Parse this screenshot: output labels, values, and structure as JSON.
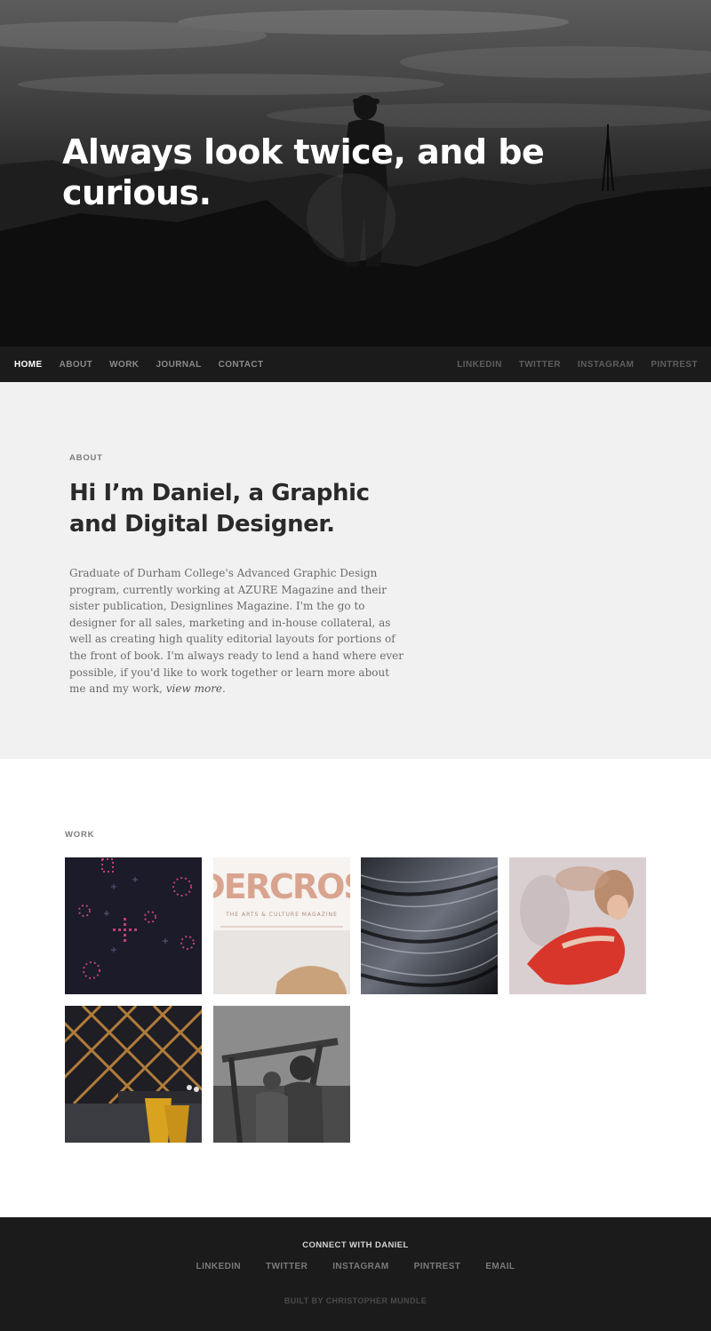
{
  "hero": {
    "title": "Always look twice, and be curious.",
    "image": "black-and-white-silhouette-on-hilltop"
  },
  "nav": {
    "left": [
      {
        "label": "HOME",
        "active": true
      },
      {
        "label": "ABOUT"
      },
      {
        "label": "WORK"
      },
      {
        "label": "JOURNAL"
      },
      {
        "label": "CONTACT"
      }
    ],
    "right": [
      {
        "label": "LINKEDIN"
      },
      {
        "label": "TWITTER"
      },
      {
        "label": "INSTAGRAM"
      },
      {
        "label": "PINTREST"
      }
    ]
  },
  "about": {
    "label": "ABOUT",
    "heading": "Hi I’m Daniel, a Graphic and Digital Designer.",
    "body": "Graduate of Durham College's Advanced Graphic Design program, currently working at AZURE Magazine and their sister publication, Designlines Magazine. I'm the go to designer for all sales, marketing and in-house collateral, as well as creating high quality editorial layouts for portions of the front of book. I'm always ready to lend a hand where ever possible, if you'd like to work together or learn more about me and my work, ",
    "link": "view more",
    "trailing": "."
  },
  "work": {
    "label": "WORK",
    "tiles": [
      {
        "name": "dark-pattern-dots"
      },
      {
        "name": "magazine-cover",
        "text": "DERCROS",
        "subtext": "THE ARTS & CULTURE MAGAZINE"
      },
      {
        "name": "metallic-texture"
      },
      {
        "name": "dancer-red-dress"
      },
      {
        "name": "restaurant-lattice"
      },
      {
        "name": "bw-workers"
      }
    ]
  },
  "footer": {
    "title": "CONNECT WITH DANIEL",
    "links": [
      {
        "label": "LINKEDIN"
      },
      {
        "label": "TWITTER"
      },
      {
        "label": "INSTAGRAM"
      },
      {
        "label": "PINTREST"
      },
      {
        "label": "EMAIL"
      }
    ],
    "credit": "BUILT BY CHRISTOPHER MUNDLE"
  }
}
